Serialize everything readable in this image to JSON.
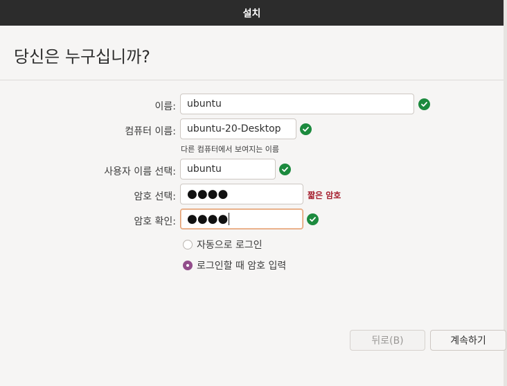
{
  "window": {
    "title": "설치"
  },
  "page": {
    "heading": "당신은 누구십니까?"
  },
  "form": {
    "name": {
      "label": "이름:",
      "value": "ubuntu",
      "valid": true
    },
    "computer_name": {
      "label": "컴퓨터 이름:",
      "value": "ubuntu-20-Desktop",
      "hint": "다른 컴퓨터에서 보여지는 이름",
      "valid": true
    },
    "username": {
      "label": "사용자 이름 선택:",
      "value": "ubuntu",
      "valid": true
    },
    "password": {
      "label": "암호 선택:",
      "masked_value": "●●●●",
      "strength": "짧은 암호"
    },
    "confirm_password": {
      "label": "암호 확인:",
      "masked_value": "●●●●",
      "valid": true
    }
  },
  "login_options": [
    {
      "label": "자동으로 로그인",
      "selected": false
    },
    {
      "label": "로그인할 때 암호 입력",
      "selected": true
    }
  ],
  "buttons": {
    "back": "뒤로(B)",
    "continue": "계속하기"
  },
  "colors": {
    "titlebar": "#2c2c2c",
    "valid": "#1c8a3e",
    "warning": "#a51d2d",
    "radio_selected": "#924d8b",
    "focus_border": "#e29b6c"
  },
  "icons": {
    "valid": "checkmark-circle-icon"
  }
}
